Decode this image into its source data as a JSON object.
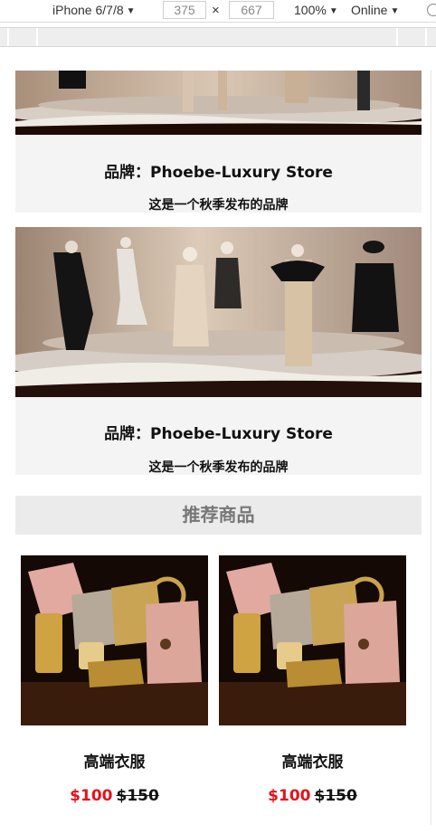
{
  "devtools": {
    "device": "iPhone 6/7/8",
    "width": "375",
    "times": "×",
    "height": "667",
    "zoom": "100%",
    "network": "Online"
  },
  "colors": {
    "price": "#e8101a",
    "card_bg": "#f4f4f4",
    "header_bg": "#ebebeb"
  },
  "brands": [
    {
      "title": "品牌：Phoebe-Luxury Store",
      "desc": "这是一个秋季发布的品牌"
    },
    {
      "title": "品牌：Phoebe-Luxury Store",
      "desc": "这是一个秋季发布的品牌"
    }
  ],
  "recommend": {
    "heading": "推荐商品"
  },
  "products": [
    {
      "name": "高端衣服",
      "price": "$100",
      "old_price": "$150"
    },
    {
      "name": "高端衣服",
      "price": "$100",
      "old_price": "$150"
    }
  ]
}
